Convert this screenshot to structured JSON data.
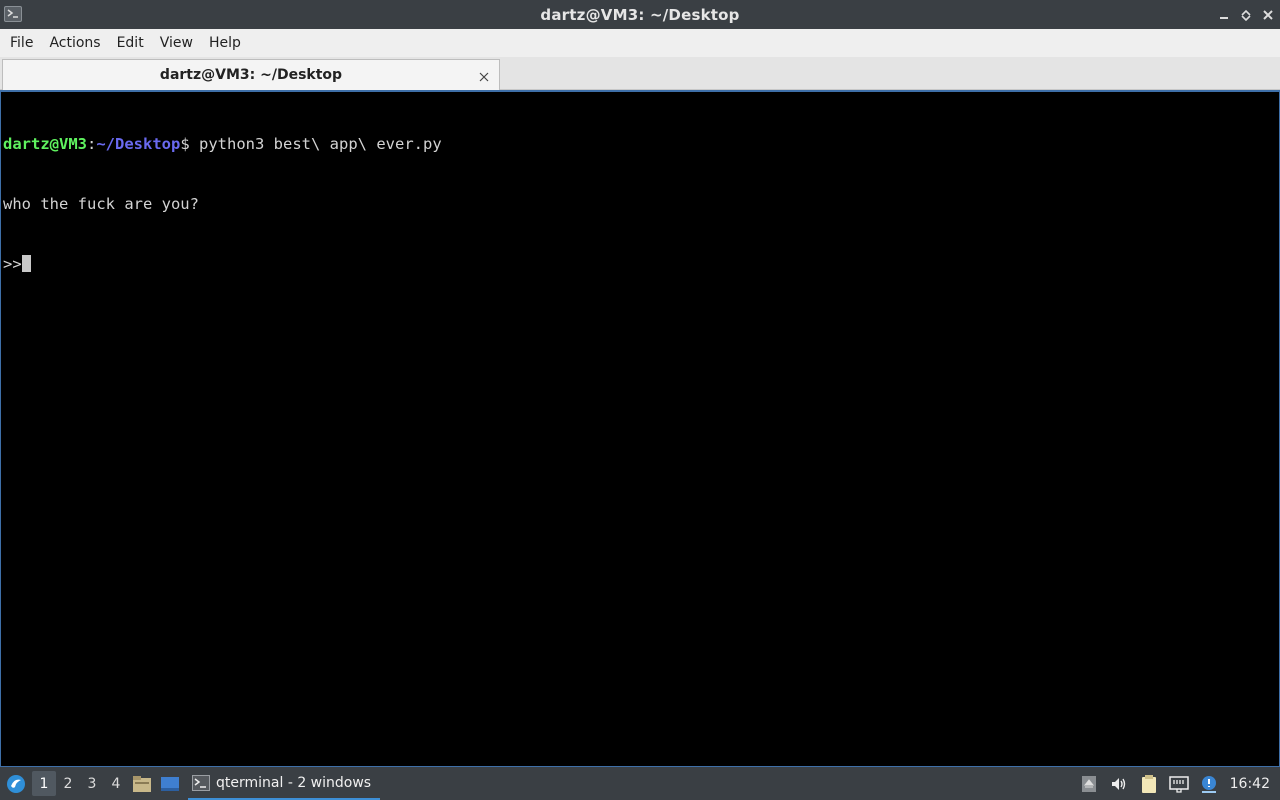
{
  "window": {
    "title": "dartz@VM3: ~/Desktop"
  },
  "menu": [
    "File",
    "Actions",
    "Edit",
    "View",
    "Help"
  ],
  "tab": {
    "label": "dartz@VM3: ~/Desktop"
  },
  "terminal": {
    "prompt_user": "dartz@VM3",
    "prompt_colon": ":",
    "prompt_path": "~/Desktop",
    "prompt_symbol": "$",
    "command": " python3 best\\ app\\ ever.py",
    "output_line": "who the fuck are you?",
    "input_prompt": ">>"
  },
  "taskbar": {
    "workspaces": [
      "1",
      "2",
      "3",
      "4"
    ],
    "active_workspace": "1",
    "task_label": "qterminal - 2 windows",
    "clock": "16:42"
  },
  "colors": {
    "prompt_user": "#5ff25f",
    "prompt_path": "#6a6af0",
    "terminal_bg": "#000000",
    "titlebar_bg": "#3a3f44",
    "accent": "#3d8fd6"
  },
  "icons": {
    "app": "terminal-icon",
    "minimize": "minimize-icon",
    "maximize": "maximize-icon",
    "close": "close-icon",
    "tab_close": "close-icon",
    "start": "lxqt-start-icon",
    "file_manager": "file-manager-icon",
    "show_desktop": "desktop-icon",
    "tray": [
      "eject-icon",
      "volume-icon",
      "clipboard-icon",
      "network-icon",
      "update-notifier-icon"
    ]
  }
}
